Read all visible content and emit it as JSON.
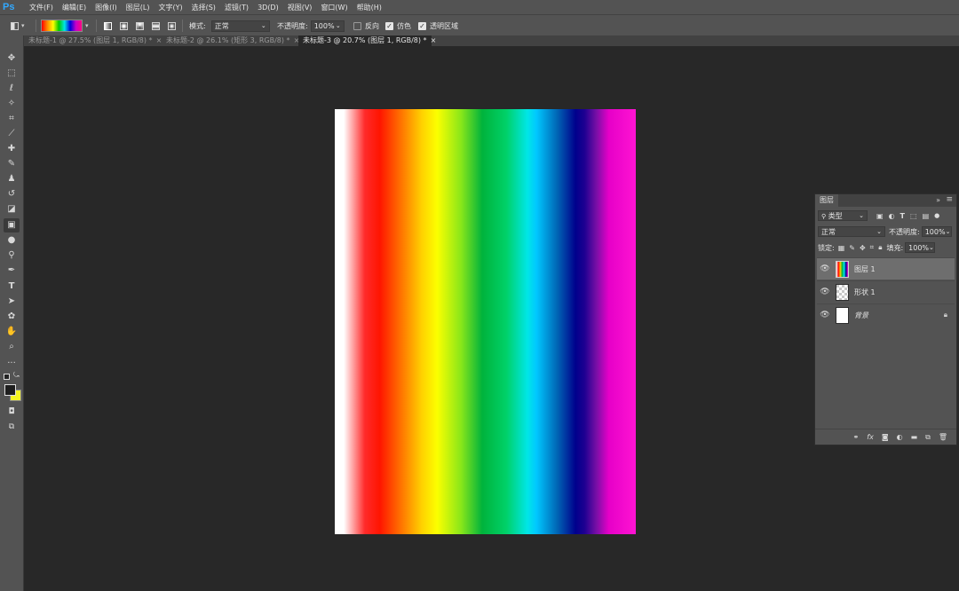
{
  "app": {
    "logo": "Ps",
    "menu": [
      "文件(F)",
      "编辑(E)",
      "图像(I)",
      "图层(L)",
      "文字(Y)",
      "选择(S)",
      "滤镜(T)",
      "3D(D)",
      "视图(V)",
      "窗口(W)",
      "帮助(H)"
    ]
  },
  "options": {
    "mode_label": "模式:",
    "mode_value": "正常",
    "opacity_label": "不透明度:",
    "opacity_value": "100%",
    "reverse_label": "反向",
    "reverse_checked": false,
    "dither_label": "仿色",
    "dither_checked": true,
    "transparency_label": "透明区域",
    "transparency_checked": true
  },
  "tabs": [
    {
      "label": "未标题-1 @ 27.5% (图层 1, RGB/8) *",
      "active": false
    },
    {
      "label": "未标题-2 @ 26.1% (矩形 3, RGB/8) *",
      "active": false
    },
    {
      "label": "未标题-3 @ 20.7% (图层 1, RGB/8) *",
      "active": true
    }
  ],
  "tab_close": "×",
  "tools": [
    {
      "name": "move-tool",
      "glyph": "✥"
    },
    {
      "name": "marquee-tool",
      "glyph": "⬚"
    },
    {
      "name": "lasso-tool",
      "glyph": "ℓ"
    },
    {
      "name": "magic-wand-tool",
      "glyph": "✧"
    },
    {
      "name": "crop-tool",
      "glyph": "⌗"
    },
    {
      "name": "eyedropper-tool",
      "glyph": "⟋"
    },
    {
      "name": "healing-brush-tool",
      "glyph": "✚"
    },
    {
      "name": "brush-tool",
      "glyph": "✎"
    },
    {
      "name": "clone-stamp-tool",
      "glyph": "♟"
    },
    {
      "name": "history-brush-tool",
      "glyph": "↺"
    },
    {
      "name": "eraser-tool",
      "glyph": "◪"
    },
    {
      "name": "gradient-tool",
      "glyph": "▣"
    },
    {
      "name": "blur-tool",
      "glyph": "●"
    },
    {
      "name": "dodge-tool",
      "glyph": "⚲"
    },
    {
      "name": "pen-tool",
      "glyph": "✒"
    },
    {
      "name": "type-tool",
      "glyph": "T"
    },
    {
      "name": "path-selection-tool",
      "glyph": "➤"
    },
    {
      "name": "shape-tool",
      "glyph": "✿"
    },
    {
      "name": "hand-tool",
      "glyph": "✋"
    },
    {
      "name": "zoom-tool",
      "glyph": "⌕"
    },
    {
      "name": "more-tools",
      "glyph": "···"
    }
  ],
  "colors": {
    "foreground": "#1e1e1e",
    "background": "#f5f520",
    "canvas_bg": "#282828",
    "ui_panel": "#535353"
  },
  "layers_panel": {
    "title": "图层",
    "filter_label": "类型",
    "blend_mode": "正常",
    "opacity_label": "不透明度:",
    "opacity_value": "100%",
    "lock_label": "锁定:",
    "fill_label": "填充:",
    "fill_value": "100%",
    "layers": [
      {
        "name": "图层 1",
        "selected": true,
        "thumb": "gradient"
      },
      {
        "name": "形状 1",
        "selected": false,
        "thumb": "transparent"
      },
      {
        "name": "背景",
        "selected": false,
        "thumb": "white",
        "locked": true
      }
    ],
    "footer_icons": [
      "link-icon",
      "fx-icon",
      "mask-icon",
      "adjustment-icon",
      "folder-icon",
      "new-layer-icon",
      "trash-icon"
    ]
  }
}
